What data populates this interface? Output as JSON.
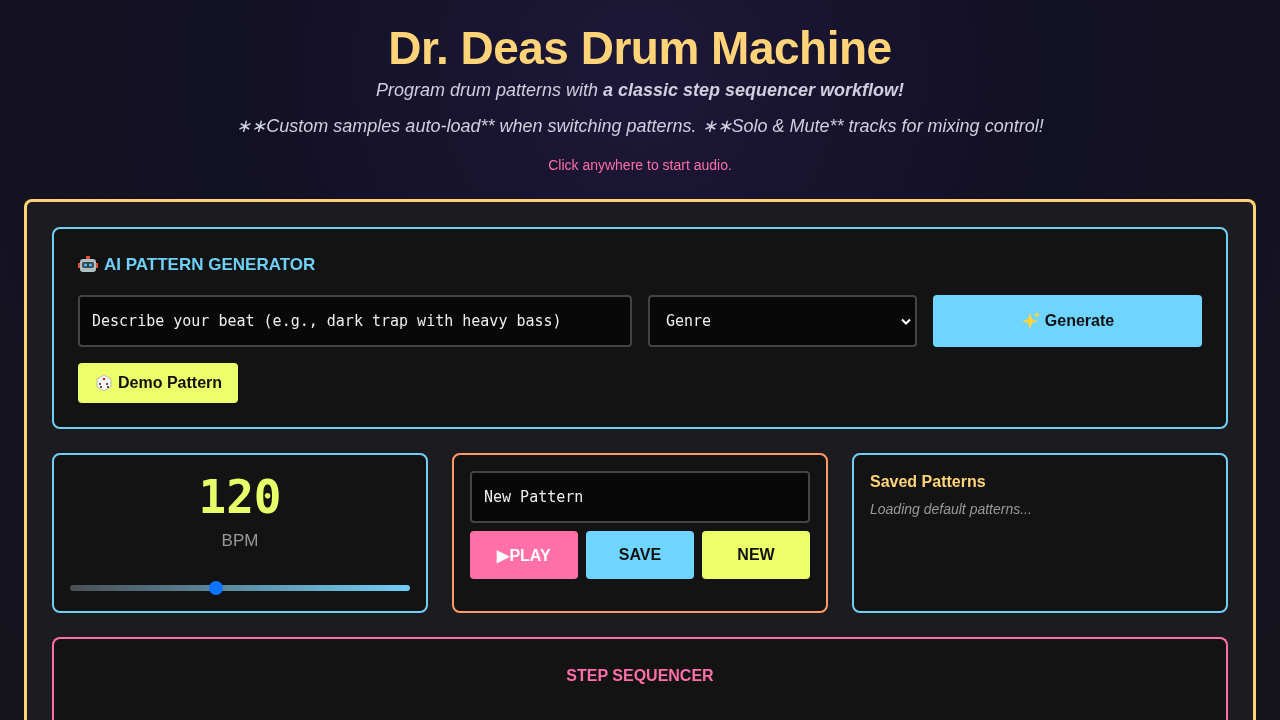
{
  "header": {
    "title": "Dr. Deas Drum Machine",
    "subtitle": "Program drum patterns with **a classic step sequencer workflow!**",
    "note": "∗∗Custom samples auto-load** when switching patterns. ∗∗Solo & Mute** tracks for mixing control!",
    "hint": "Click anywhere to start audio."
  },
  "ai_generator": {
    "title": "AI PATTERN GENERATOR",
    "prompt": {
      "placeholder": "Describe your beat (e.g., dark trap with heavy bass)"
    },
    "genre": {
      "value": "Genre"
    },
    "generate_button": "Generate",
    "demo_button": "Demo Pattern"
  },
  "tempo": {
    "value": "120",
    "unit": "BPM",
    "level": 0.43
  },
  "pattern": {
    "name": "New Pattern",
    "buttons": [
      {
        "kind": "play",
        "label": "▶PLAY"
      },
      {
        "kind": "save",
        "label": "SAVE"
      },
      {
        "kind": "new",
        "label": "NEW"
      }
    ]
  },
  "saved_patterns": {
    "title": "Saved Patterns",
    "status": "Loading default patterns..."
  },
  "sequencer": {
    "title": "STEP SEQUENCER"
  }
}
